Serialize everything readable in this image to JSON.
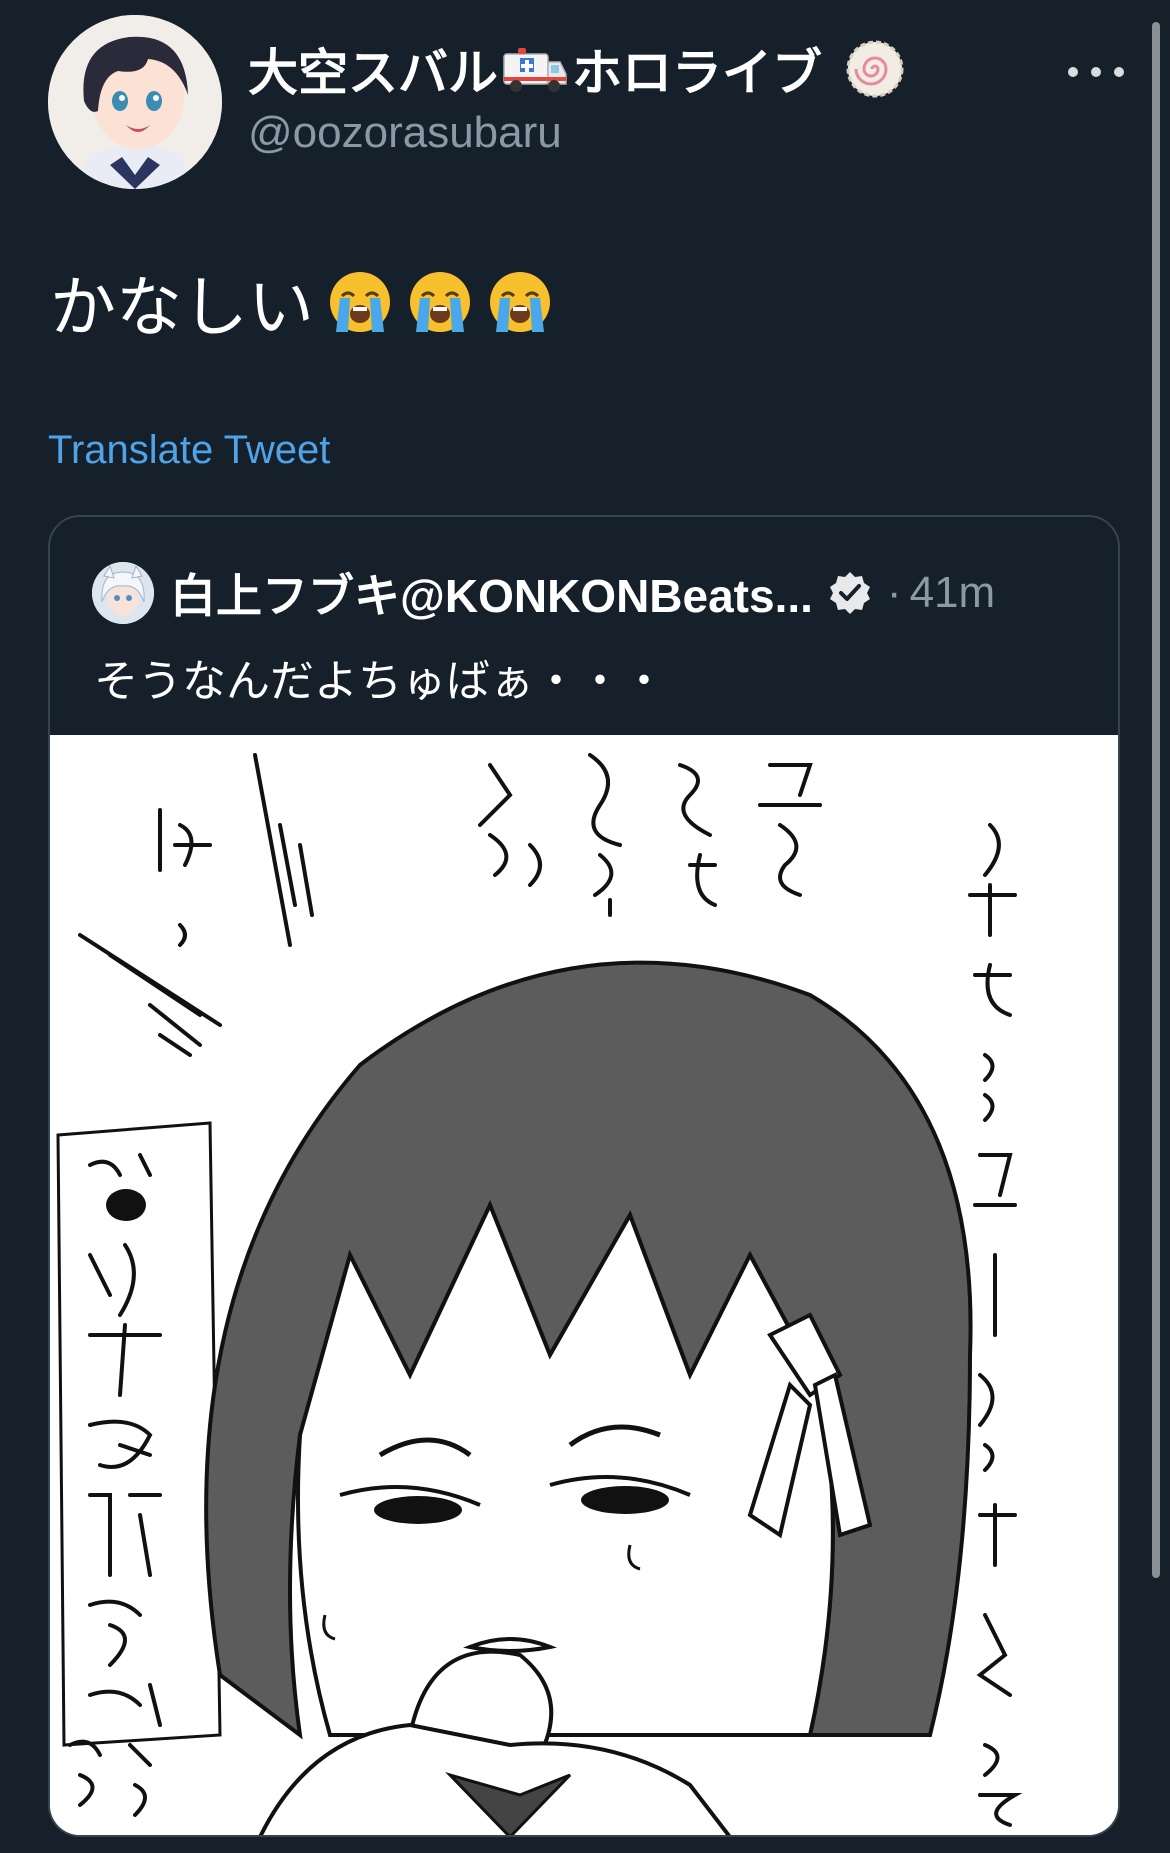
{
  "author": {
    "display_name": "大空スバル",
    "name_emoji": "ambulance-icon",
    "name_suffix": "ホロライブ",
    "badge_icon": "narutomaki-badge-icon",
    "handle": "@oozorasubaru",
    "avatar_icon": "avatar-image"
  },
  "tweet": {
    "text": "かなしい",
    "emojis": [
      "loudly-crying-face-icon",
      "loudly-crying-face-icon",
      "loudly-crying-face-icon"
    ]
  },
  "translate_label": "Translate Tweet",
  "more_icon": "more-options-icon",
  "quoted": {
    "name": "白上フブキ@KONKONBeats...",
    "verified_icon": "verified-badge-icon",
    "separator": "·",
    "time": "41m",
    "text": "そうなんだよちゅばぁ・・・",
    "media_icon": "manga-illustration-image"
  },
  "colors": {
    "background": "#15202b",
    "secondary_text": "#8b98a5",
    "link": "#4fa3e8",
    "border": "#38444d"
  }
}
